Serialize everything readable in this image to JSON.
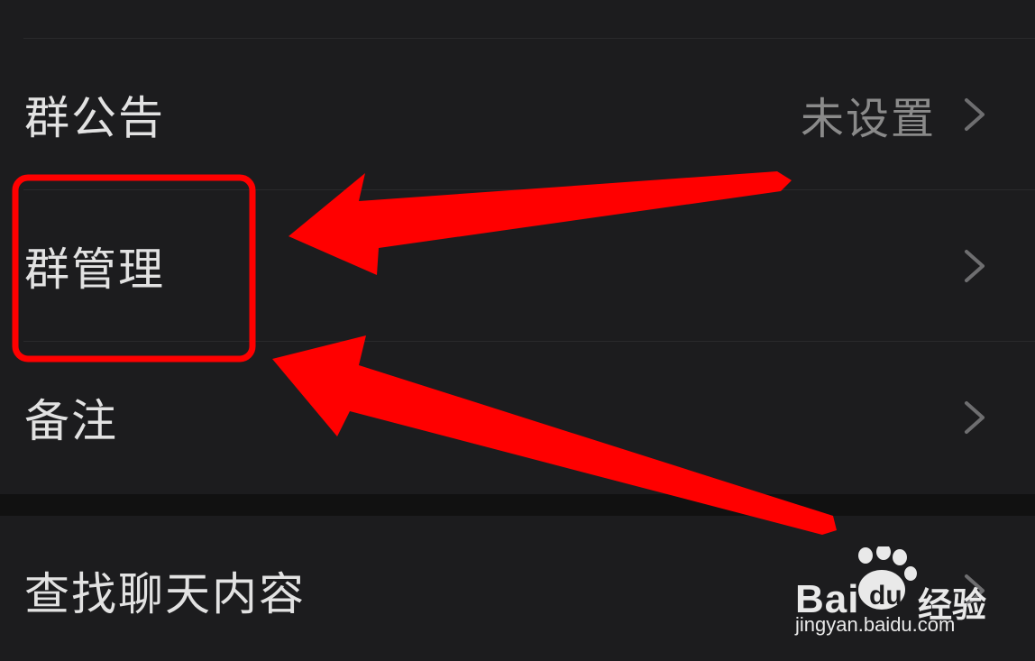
{
  "settings_list": {
    "rows": [
      {
        "label": "群公告",
        "value": "未设置"
      },
      {
        "label": "群管理",
        "value": ""
      },
      {
        "label": "备注",
        "value": ""
      },
      {
        "label": "查找聊天内容",
        "value": ""
      }
    ]
  },
  "annotation": {
    "color": "#ff0000"
  },
  "watermark": {
    "brand": "Bai",
    "brand_suffix": "经验",
    "url": "jingyan.baidu.com",
    "logo_text": "du"
  }
}
